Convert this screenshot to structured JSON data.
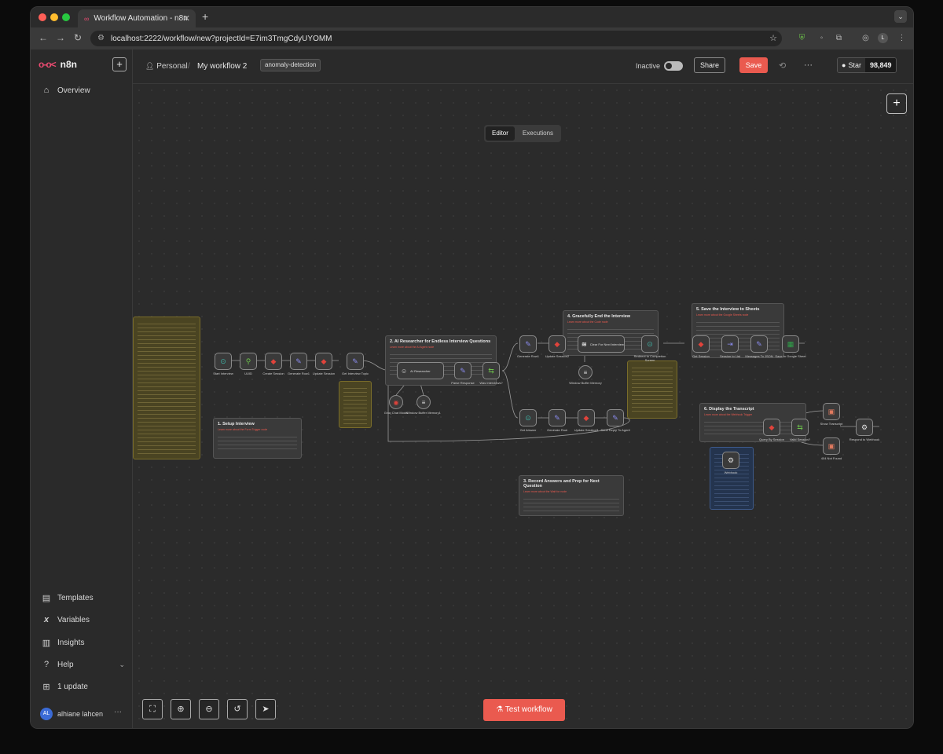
{
  "browser": {
    "tab_title": "Workflow Automation - n8n",
    "url": "localhost:2222/workflow/new?projectId=E7im3TmgCdyUYOMM"
  },
  "sidebar": {
    "logo": "n8n",
    "items": [
      {
        "label": "Overview",
        "icon": "home-icon"
      },
      {
        "label": "Templates",
        "icon": "templates-icon"
      },
      {
        "label": "Variables",
        "icon": "variables-icon"
      },
      {
        "label": "Insights",
        "icon": "insights-icon"
      },
      {
        "label": "Help",
        "icon": "help-icon"
      },
      {
        "label": "1 update",
        "icon": "gift-icon"
      }
    ],
    "user_initials": "AL",
    "user_name": "alhiane lahcen"
  },
  "header": {
    "project": "Personal",
    "workflow_name": "My workflow 2",
    "tag": "anomaly-detection",
    "status": "Inactive",
    "share": "Share",
    "save": "Save",
    "github_star": "Star",
    "github_count": "98,849"
  },
  "canvas": {
    "tabs": [
      "Editor",
      "Executions"
    ],
    "active_tab": "Editor",
    "test_button": "Test workflow",
    "notes": [
      {
        "title": "1. Setup Interview",
        "subtitle": "Learn more about the Form Trigger node"
      },
      {
        "title": "2. AI Researcher for Endless Interview Questions",
        "subtitle": "Learn more about the AI Agent node"
      },
      {
        "title": "3. Record Answers and Prep for Next Question",
        "subtitle": "Learn more about the Wait for node"
      },
      {
        "title": "4. Gracefully End the Interview",
        "subtitle": "Learn more about the Code node"
      },
      {
        "title": "5. Save the Interview to Sheets",
        "subtitle": "Learn more about the Google Sheets node"
      },
      {
        "title": "6. Display the Transcript",
        "subtitle": "Learn more about the Webhook Trigger"
      }
    ],
    "nodes": [
      "Start Interview",
      "UUID",
      "Create Session",
      "Generate Row1",
      "Update Session",
      "Get Interview Topic",
      "AI Researcher",
      "Parse Response",
      "Was Interviews?",
      "Groq Chat Model",
      "Window Buffer Memory1",
      "Generate Row1",
      "Update Session2",
      "Clear For Next Interview",
      "Window Buffer Memory",
      "Redirect to Completion Screen",
      "Get Session",
      "Session to List",
      "Messages To JSON",
      "Save to Google Sheet",
      "Get Answer",
      "Generate Row",
      "Update Session3",
      "Send Reply To Agent",
      "Webhook",
      "Query By Session",
      "Valid Session?",
      "Show Transcript",
      "404 Not Found",
      "Respond to Webhook"
    ]
  }
}
